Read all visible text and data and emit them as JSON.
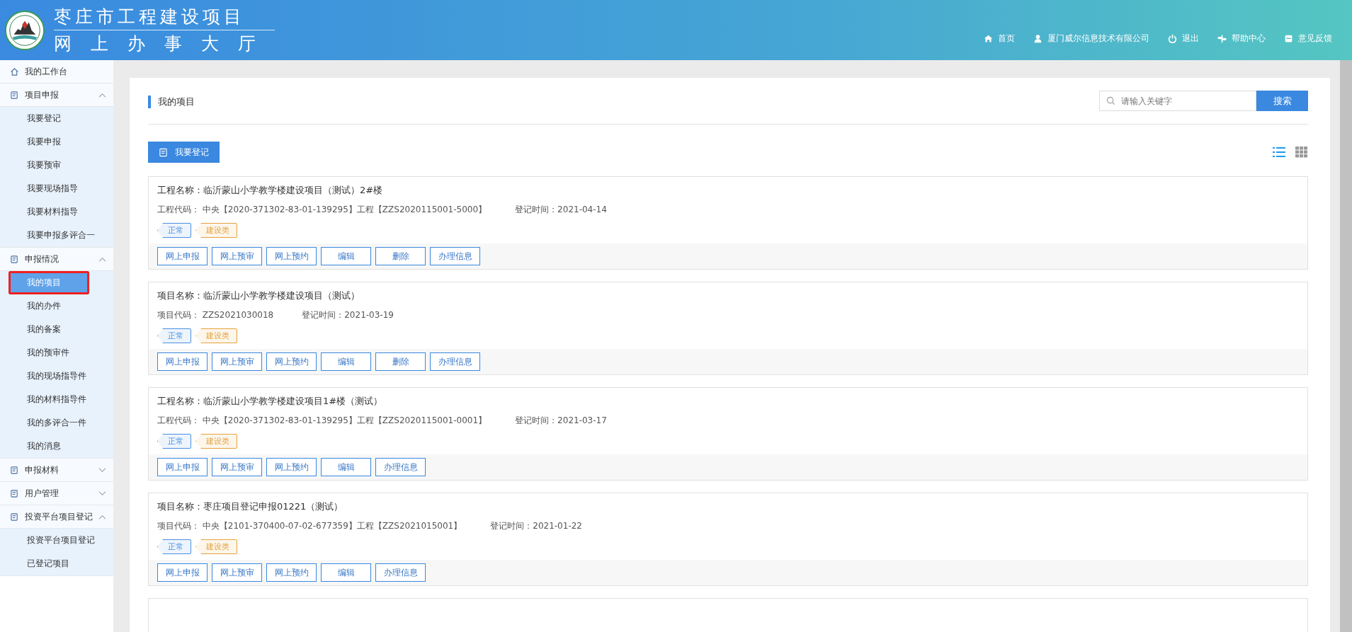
{
  "header": {
    "title_line1": "枣庄市工程建设项目",
    "title_line2": "网上办事大厅",
    "nav": [
      {
        "label": "首页"
      },
      {
        "label": "厦门威尔信息技术有限公司"
      },
      {
        "label": "退出"
      },
      {
        "label": "帮助中心"
      },
      {
        "label": "意见反馈"
      }
    ]
  },
  "sidebar": {
    "items": [
      {
        "label": "我的工作台",
        "kind": "link"
      },
      {
        "label": "项目申报",
        "kind": "group",
        "expanded": true,
        "children": [
          {
            "label": "我要登记",
            "selected": false
          },
          {
            "label": "我要申报",
            "selected": false
          },
          {
            "label": "我要预审",
            "selected": false
          },
          {
            "label": "我要现场指导",
            "selected": false
          },
          {
            "label": "我要材料指导",
            "selected": false
          },
          {
            "label": "我要申报多评合一",
            "selected": false
          }
        ]
      },
      {
        "label": "申报情况",
        "kind": "group",
        "expanded": true,
        "children": [
          {
            "label": "我的项目",
            "selected": true
          },
          {
            "label": "我的办件",
            "selected": false
          },
          {
            "label": "我的备案",
            "selected": false
          },
          {
            "label": "我的预审件",
            "selected": false
          },
          {
            "label": "我的现场指导件",
            "selected": false
          },
          {
            "label": "我的材料指导件",
            "selected": false
          },
          {
            "label": "我的多评合一件",
            "selected": false
          },
          {
            "label": "我的消息",
            "selected": false
          }
        ]
      },
      {
        "label": "申报材料",
        "kind": "group",
        "expanded": false
      },
      {
        "label": "用户管理",
        "kind": "group",
        "expanded": false
      },
      {
        "label": "投资平台项目登记",
        "kind": "group",
        "expanded": true,
        "children": [
          {
            "label": "投资平台项目登记",
            "selected": false
          },
          {
            "label": "已登记项目",
            "selected": false
          }
        ]
      }
    ]
  },
  "panel": {
    "title": "我的项目",
    "search": {
      "placeholder": "请输入关键字",
      "button": "搜索"
    },
    "register_button": "我要登记",
    "view_modes": [
      {
        "selected": true
      },
      {
        "selected": false
      }
    ],
    "projects": [
      {
        "name_label": "工程名称：",
        "name": "临沂蒙山小学教学楼建设项目（测试）2#楼",
        "code_label": "工程代码：",
        "code": "中央【2020-371302-83-01-139295】工程【ZZS2020115001-5000】",
        "date_label": "登记时间：",
        "date": "2021-04-14",
        "tags": [
          {
            "label": "正常",
            "color": "#4a90e2"
          },
          {
            "label": "建设类",
            "color": "#e6a23c"
          }
        ],
        "actions": [
          "网上申报",
          "网上预审",
          "网上预约",
          "编辑",
          "删除",
          "办理信息"
        ]
      },
      {
        "name_label": "项目名称：",
        "name": "临沂蒙山小学教学楼建设项目（测试）",
        "code_label": "项目代码：",
        "code": "ZZS2021030018",
        "date_label": "登记时间：",
        "date": "2021-03-19",
        "tags": [
          {
            "label": "正常",
            "color": "#4a90e2"
          },
          {
            "label": "建设类",
            "color": "#e6a23c"
          }
        ],
        "actions": [
          "网上申报",
          "网上预审",
          "网上预约",
          "编辑",
          "删除",
          "办理信息"
        ]
      },
      {
        "name_label": "工程名称：",
        "name": "临沂蒙山小学教学楼建设项目1#楼（测试）",
        "code_label": "工程代码：",
        "code": "中央【2020-371302-83-01-139295】工程【ZZS2020115001-0001】",
        "date_label": "登记时间：",
        "date": "2021-03-17",
        "tags": [
          {
            "label": "正常",
            "color": "#4a90e2"
          },
          {
            "label": "建设类",
            "color": "#e6a23c"
          }
        ],
        "actions": [
          "网上申报",
          "网上预审",
          "网上预约",
          "编辑",
          "办理信息"
        ]
      },
      {
        "name_label": "项目名称：",
        "name": "枣庄项目登记申报01221（测试）",
        "code_label": "项目代码：",
        "code": "中央【2101-370400-07-02-677359】工程【ZZS2021015001】",
        "date_label": "登记时间：",
        "date": "2021-01-22",
        "tags": [
          {
            "label": "正常",
            "color": "#4a90e2"
          },
          {
            "label": "建设类",
            "color": "#e6a23c"
          }
        ],
        "actions": [
          "网上申报",
          "网上预审",
          "网上预约",
          "编辑",
          "办理信息"
        ]
      }
    ]
  }
}
